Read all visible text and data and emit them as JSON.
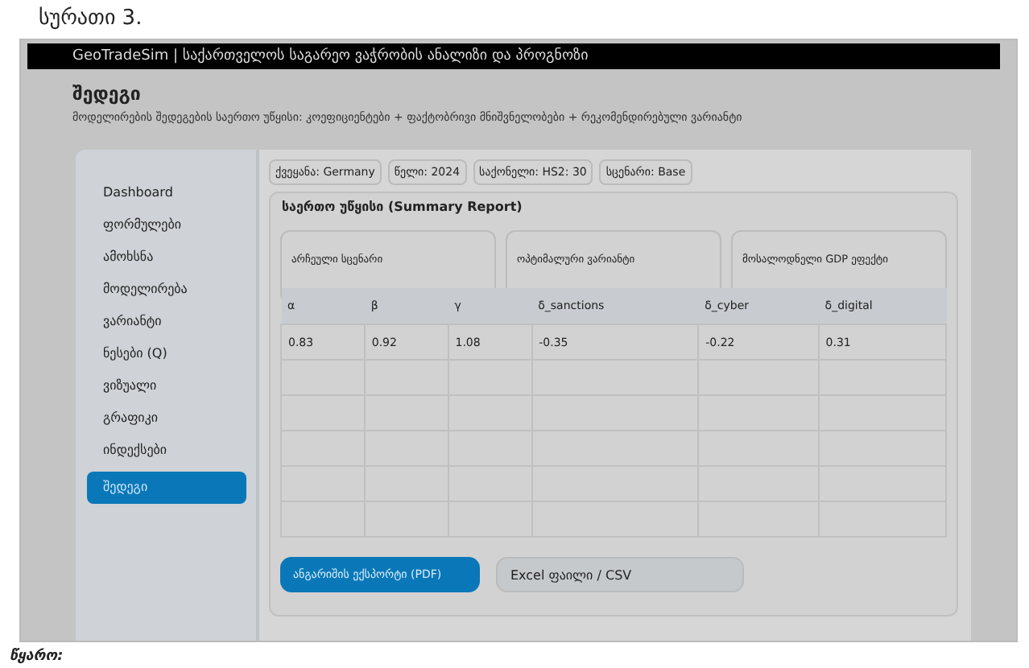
{
  "caption": "სურათი 3.",
  "window": {
    "title": "GeoTradeSim | საქართველოს საგარეო ვაჭრობის ანალიზი და პროგნოზი"
  },
  "page": {
    "heading": "შედეგი",
    "subtitle": "მოდელირების შედეგების საერთო უწყისი: კოეფიციენტები + ფაქტობრივი მნიშვნელობები + რეკომენდირებული ვარიანტი"
  },
  "sidebar": {
    "items": [
      {
        "label": "Dashboard",
        "selected": false
      },
      {
        "label": "ფორმულები",
        "selected": false
      },
      {
        "label": "ამოხსნა",
        "selected": false
      },
      {
        "label": "მოდელირება",
        "selected": false
      },
      {
        "label": "ვარიანტი",
        "selected": false
      },
      {
        "label": "ნესები (Q)",
        "selected": false
      },
      {
        "label": "ვიზუალი",
        "selected": false
      },
      {
        "label": "გრაფიკი",
        "selected": false
      },
      {
        "label": "ინდექსები",
        "selected": false
      },
      {
        "label": "შედეგი",
        "selected": true
      }
    ]
  },
  "filters": [
    "ქვეყანა: Germany",
    "წელი: 2024",
    "საქონელი: HS2: 30",
    "სცენარი: Base"
  ],
  "report": {
    "title": "საერთო უწყისი (Summary Report)",
    "cards": [
      "არჩეული სცენარი",
      "ოპტიმალური ვარიანტი",
      "მოსალოდნელი GDP ეფექტი"
    ],
    "table": {
      "columns": [
        "α",
        "β",
        "γ",
        "δ_sanctions",
        "δ_cyber",
        "δ_digital"
      ],
      "rows": [
        [
          "0.83",
          "0.92",
          "1.08",
          "-0.35",
          "-0.22",
          "0.31"
        ]
      ]
    }
  },
  "buttons": [
    {
      "label": "ანგარიშის ექსპორტი (PDF)",
      "kind": "primary"
    },
    {
      "label": "Excel ფაილი / CSV",
      "kind": "secondary"
    }
  ],
  "footer": "წყარო:"
}
